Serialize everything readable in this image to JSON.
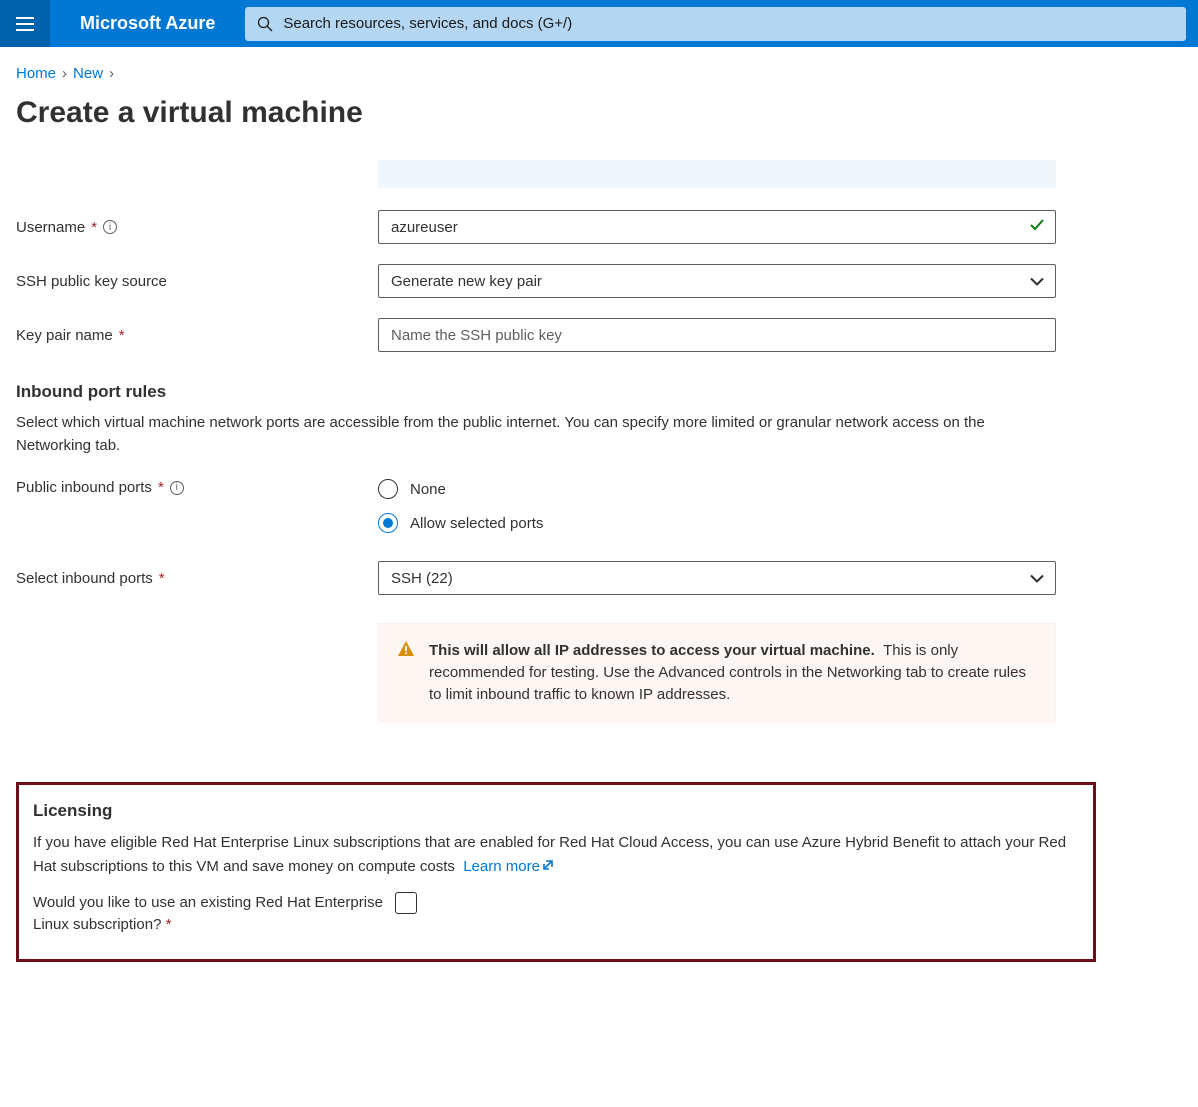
{
  "header": {
    "brand": "Microsoft Azure",
    "search_placeholder": "Search resources, services, and docs (G+/)"
  },
  "breadcrumb": {
    "home": "Home",
    "new": "New"
  },
  "page_title": "Create a virtual machine",
  "form": {
    "username_label": "Username",
    "username_value": "azureuser",
    "ssh_source_label": "SSH public key source",
    "ssh_source_value": "Generate new key pair",
    "keypair_label": "Key pair name",
    "keypair_placeholder": "Name the SSH public key"
  },
  "inbound": {
    "heading": "Inbound port rules",
    "desc": "Select which virtual machine network ports are accessible from the public internet. You can specify more limited or granular network access on the Networking tab.",
    "public_label": "Public inbound ports",
    "option_none": "None",
    "option_allow": "Allow selected ports",
    "select_label": "Select inbound ports",
    "select_value": "SSH (22)",
    "warn_bold": "This will allow all IP addresses to access your virtual machine.",
    "warn_rest": "This is only recommended for testing.  Use the Advanced controls in the Networking tab to create rules to limit inbound traffic to known IP addresses."
  },
  "licensing": {
    "heading": "Licensing",
    "desc": "If you have eligible Red Hat Enterprise Linux subscriptions that are enabled for Red Hat Cloud Access, you can use Azure Hybrid Benefit to attach your Red Hat subscriptions to this VM and save money on compute costs",
    "learn_more": "Learn more",
    "checkbox_label": "Would you like to use an existing Red Hat Enterprise Linux subscription?"
  }
}
